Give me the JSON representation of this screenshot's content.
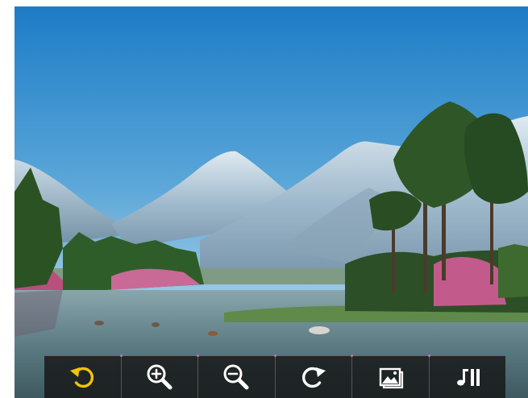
{
  "viewer": {
    "image": {
      "subject": "mountain-lake-landscape"
    },
    "colors": {
      "sky_top": "#1f7fc8",
      "sky_bottom": "#cde3ec",
      "mountain": "#a9c4d6",
      "water": "#5f7f86",
      "foliage": "#2f5a2c",
      "flowers": "#c85e8e",
      "toolbar_bg": "#1a1a1a",
      "accent": "#f2c40b",
      "icon": "#ffffff"
    }
  },
  "toolbar": {
    "buttons": [
      {
        "id": "undo",
        "icon": "rotate-left-icon",
        "active": true
      },
      {
        "id": "zoom-in",
        "icon": "zoom-in-icon",
        "active": false
      },
      {
        "id": "zoom-out",
        "icon": "zoom-out-icon",
        "active": false
      },
      {
        "id": "rotate",
        "icon": "rotate-right-icon",
        "active": false
      },
      {
        "id": "slideshow",
        "icon": "picture-icon",
        "active": false
      },
      {
        "id": "music",
        "icon": "music-play-pause-icon",
        "active": false
      }
    ]
  }
}
